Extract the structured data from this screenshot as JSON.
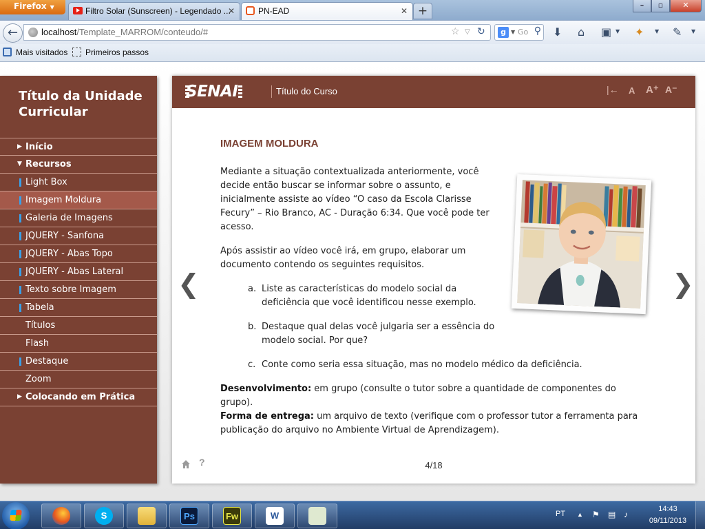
{
  "browser": {
    "app_button": "Firefox",
    "tabs": [
      {
        "title": "Filtro Solar (Sunscreen) - Legendado ..."
      },
      {
        "title": "PN-EAD"
      }
    ],
    "url_host": "localhost",
    "url_path": "/Template_MARROM/conteudo/#",
    "search_engine": "g",
    "search_placeholder": "Go",
    "bookmarks": [
      "Mais visitados",
      "Primeiros passos"
    ]
  },
  "sidebar": {
    "unit_title": "Título da Unidade Curricular",
    "menu": [
      {
        "label": "Início",
        "kind": "section",
        "arrow": "▶"
      },
      {
        "label": "Recursos",
        "kind": "section",
        "arrow": "▼"
      },
      {
        "label": "Light Box",
        "kind": "item",
        "bar": true
      },
      {
        "label": "Imagem Moldura",
        "kind": "item",
        "bar": true,
        "active": true
      },
      {
        "label": "Galeria de Imagens",
        "kind": "item",
        "bar": true
      },
      {
        "label": "JQUERY - Sanfona",
        "kind": "item",
        "bar": true
      },
      {
        "label": "JQUERY - Abas Topo",
        "kind": "item",
        "bar": true
      },
      {
        "label": "JQUERY - Abas Lateral",
        "kind": "item",
        "bar": true
      },
      {
        "label": "Texto sobre Imagem",
        "kind": "item",
        "bar": true
      },
      {
        "label": "Tabela",
        "kind": "item",
        "bar": true
      },
      {
        "label": "Títulos",
        "kind": "item",
        "bar": false
      },
      {
        "label": "Flash",
        "kind": "item",
        "bar": false
      },
      {
        "label": "Destaque",
        "kind": "item",
        "bar": true
      },
      {
        "label": "Zoom",
        "kind": "item",
        "bar": false
      },
      {
        "label": "Colocando em Prática",
        "kind": "section",
        "arrow": "▶"
      }
    ]
  },
  "header": {
    "logo": "SENAI",
    "course_title": "Título do Curso",
    "tools": [
      "|←",
      "A",
      "A⁺",
      "A⁻"
    ]
  },
  "content": {
    "title": "IMAGEM MOLDURA",
    "intro_lines": [
      "Mediante a situação contextualizada anteriormente, você",
      "decide então buscar se informar sobre o assunto, e",
      "inicialmente assiste ao vídeo “O caso da Escola Clarisse",
      "Fecury” – Rio Branco, AC - Duração 6:34. Que você pode ter",
      "acesso."
    ],
    "after_lines": [
      "Após assistir ao vídeo você irá, em grupo, elaborar um",
      "documento contendo os seguintes requisitos."
    ],
    "list": [
      {
        "letter": "a.",
        "lines": [
          "Liste as características do modelo social da",
          "deficiência que você identificou nesse exemplo."
        ]
      },
      {
        "letter": "b.",
        "lines": [
          "Destaque qual delas você julgaria ser a essência do",
          "modelo social. Por que?"
        ]
      },
      {
        "letter": "c.",
        "lines": [
          "Conte como seria essa situação, mas no modelo médico da deficiência."
        ]
      }
    ],
    "dev_label": "Desenvolvimento:",
    "dev_line1": " em grupo (consulte o tutor sobre a quantidade de componentes do",
    "dev_line2": "grupo).",
    "delivery_label": "Forma de entrega:",
    "delivery_line1": " um arquivo de texto (verifique com o professor tutor a ferramenta para",
    "delivery_line2": "publicação do arquivo no Ambiente Virtual de Aprendizagem).",
    "page_indicator": "4/18",
    "prev_arrow": "❮",
    "next_arrow": "❯",
    "help": "?"
  },
  "taskbar": {
    "apps": [
      {
        "name": "firefox",
        "label": "",
        "color": "#e8571e"
      },
      {
        "name": "skype",
        "label": "S",
        "color": "#00aff0"
      },
      {
        "name": "explorer",
        "label": "",
        "color": "#f2c94c"
      },
      {
        "name": "photoshop",
        "label": "Ps",
        "color": "#0a1a3a"
      },
      {
        "name": "fireworks",
        "label": "Fw",
        "color": "#3a3a0a"
      },
      {
        "name": "word",
        "label": "W",
        "color": "#ffffff"
      },
      {
        "name": "notepad",
        "label": "",
        "color": "#dfe9d0"
      }
    ],
    "language": "PT",
    "time": "14:43",
    "date": "09/11/2013"
  }
}
